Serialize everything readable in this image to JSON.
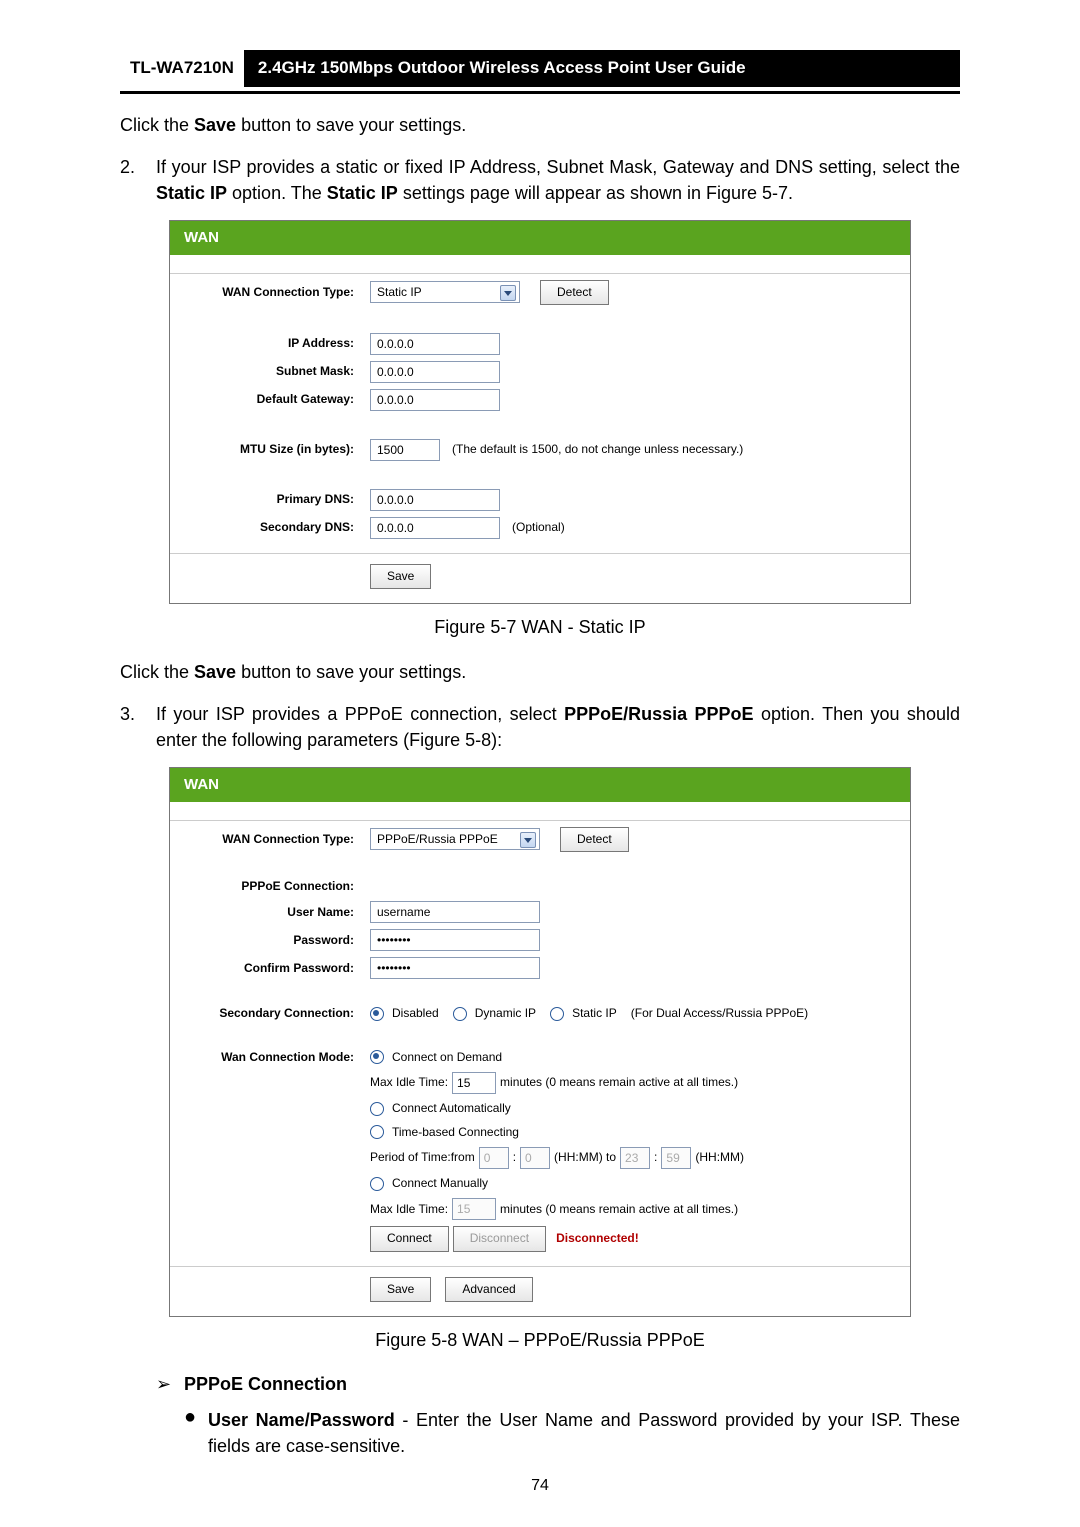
{
  "header": {
    "model": "TL-WA7210N",
    "title": "2.4GHz 150Mbps Outdoor Wireless Access Point User Guide"
  },
  "intro": {
    "click_save_1": "Click the ",
    "save_word": "Save",
    "click_save_2": " button to save your settings."
  },
  "item2": {
    "num": "2.",
    "text_a": "If your ISP provides a static or fixed IP Address, Subnet Mask, Gateway and DNS setting, select the ",
    "static_ip": "Static IP",
    "text_b": " option. The ",
    "text_c": " settings page will appear as shown in Figure 5-7."
  },
  "fig1": {
    "heading": "WAN",
    "rows": {
      "conn_type_label": "WAN Connection Type:",
      "conn_type_value": "Static IP",
      "detect": "Detect",
      "ip_label": "IP Address:",
      "ip_value": "0.0.0.0",
      "mask_label": "Subnet Mask:",
      "mask_value": "0.0.0.0",
      "gw_label": "Default Gateway:",
      "gw_value": "0.0.0.0",
      "mtu_label": "MTU Size (in bytes):",
      "mtu_value": "1500",
      "mtu_note": "(The default is 1500, do not change unless necessary.)",
      "pdns_label": "Primary DNS:",
      "pdns_value": "0.0.0.0",
      "sdns_label": "Secondary DNS:",
      "sdns_value": "0.0.0.0",
      "sdns_note": "(Optional)",
      "save": "Save"
    },
    "caption": "Figure 5-7 WAN - Static IP"
  },
  "para_after1_a": "Click the ",
  "para_after1_b": " button to save your settings.",
  "item3": {
    "num": "3.",
    "text_a": "If your ISP provides a PPPoE connection, select ",
    "pppoe": "PPPoE/Russia PPPoE",
    "text_b": " option. Then you should enter the following parameters (Figure 5-8):"
  },
  "fig2": {
    "heading": "WAN",
    "conn_type_label": "WAN Connection Type:",
    "conn_type_value": "PPPoE/Russia PPPoE",
    "detect": "Detect",
    "pppoe_conn_label": "PPPoE Connection:",
    "user_label": "User Name:",
    "user_value": "username",
    "pass_label": "Password:",
    "pass_value": "••••••••",
    "cpass_label": "Confirm Password:",
    "cpass_value": "••••••••",
    "sec_conn_label": "Secondary Connection:",
    "sec_opts": {
      "disabled": "Disabled",
      "dynamic": "Dynamic IP",
      "static": "Static IP",
      "note": "(For Dual Access/Russia PPPoE)"
    },
    "mode_label": "Wan Connection Mode:",
    "mode": {
      "on_demand": "Connect on Demand",
      "max_idle1_label": "Max Idle Time:",
      "max_idle1_value": "15",
      "max_idle_note": "minutes (0 means remain active at all times.)",
      "auto": "Connect Automatically",
      "timebased": "Time-based Connecting",
      "period_label": "Period of Time:from",
      "p_hh1": "0",
      "p_mm1": "0",
      "hhmm1": "(HH:MM) to",
      "p_hh2": "23",
      "p_mm2": "59",
      "hhmm2": "(HH:MM)",
      "manual": "Connect Manually",
      "max_idle2_label": "Max Idle Time:",
      "max_idle2_value": "15",
      "connect": "Connect",
      "disconnect": "Disconnect",
      "status": "Disconnected!"
    },
    "save": "Save",
    "advanced": "Advanced",
    "caption": "Figure 5-8 WAN – PPPoE/Russia PPPoE"
  },
  "post": {
    "arrow": "➢",
    "pppoe_h": "PPPoE Connection",
    "bullet": "●",
    "unp_bold": "User Name/Password",
    "unp_text": " - Enter the User Name and Password provided by your ISP. These fields are case-sensitive."
  },
  "page_number": "74"
}
